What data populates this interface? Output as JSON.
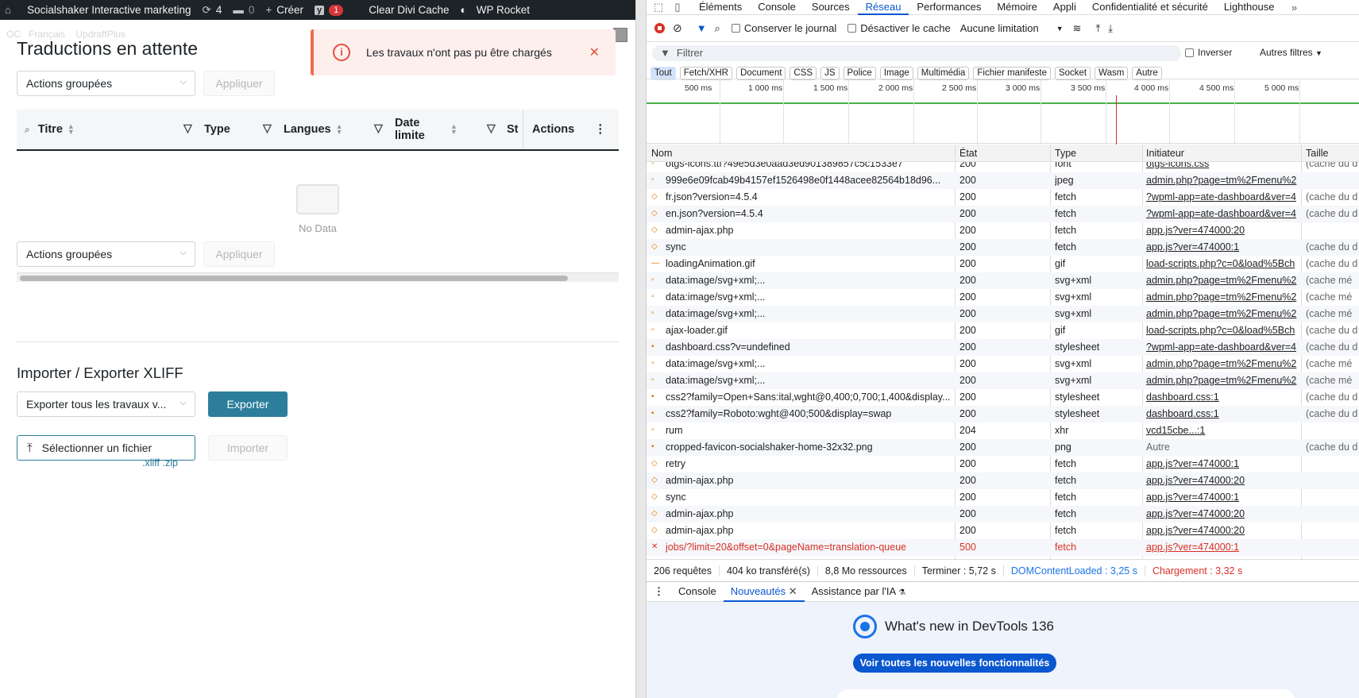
{
  "adminbar": {
    "site_name": "Socialshaker Interactive marketing",
    "updates_count": "4",
    "comments_count": "0",
    "create_label": "Créer",
    "yoast_badge": "1",
    "clear_cache": "Clear Divi Cache",
    "wp_rocket": "WP Rocket"
  },
  "subbar": {
    "lang": "Français",
    "plugin": "UpdraftPlus"
  },
  "page": {
    "title": "Traductions en attente",
    "notice_text": "Les travaux n'ont pas pu être chargés",
    "bulk_actions": "Actions groupées",
    "apply": "Appliquer",
    "no_data": "No Data",
    "columns": {
      "titre": "Titre",
      "type": "Type",
      "langues": "Langues",
      "date_limite_1": "Date",
      "date_limite_2": "limite",
      "statut_trunc": "St",
      "actions": "Actions"
    },
    "xliff_title": "Importer / Exporter XLIFF",
    "export_select": "Exporter tous les travaux v...",
    "export_button": "Exporter",
    "select_file": "Sélectionner un fichier",
    "import_button": "Importer",
    "extensions": ".xliff .zip"
  },
  "devtools": {
    "tabs": [
      "Éléments",
      "Console",
      "Sources",
      "Réseau",
      "Performances",
      "Mémoire",
      "Appli",
      "Confidentialité et sécurité",
      "Lighthouse"
    ],
    "active_tab": "Réseau",
    "toolbar": {
      "preserve_log": "Conserver le journal",
      "disable_cache": "Désactiver le cache",
      "throttle": "Aucune limitation"
    },
    "filter_placeholder": "Filtrer",
    "invert": "Inverser",
    "other_filters": "Autres filtres",
    "chips": [
      "Tout",
      "Fetch/XHR",
      "Document",
      "CSS",
      "JS",
      "Police",
      "Image",
      "Multimédia",
      "Fichier manifeste",
      "Socket",
      "Wasm",
      "Autre"
    ],
    "timeline_labels": [
      "500 ms",
      "1 000 ms",
      "1 500 ms",
      "2 000 ms",
      "2 500 ms",
      "3 000 ms",
      "3 500 ms",
      "4 000 ms",
      "4 500 ms",
      "5 000 ms"
    ],
    "columns": {
      "name": "Nom",
      "status": "État",
      "type": "Type",
      "initiator": "Initiateur",
      "size": "Taille"
    },
    "rows": [
      {
        "name": "otgs-icons.ttf?49e5d3e0aad3ed901389857c5c1533e7",
        "status": "200",
        "type": "font",
        "initiator": "otgs-icons.css",
        "size": "(cache du d",
        "icon": "▫"
      },
      {
        "name": "999e6e09fcab49b4157ef1526498e0f1448acee82564b18d96...",
        "status": "200",
        "type": "jpeg",
        "initiator": "admin.php?page=tm%2Fmenu%2",
        "size": "",
        "icon": "▫"
      },
      {
        "name": "fr.json?version=4.5.4",
        "status": "200",
        "type": "fetch",
        "initiator": "?wpml-app=ate-dashboard&ver=4",
        "size": "(cache du d",
        "icon": "◇"
      },
      {
        "name": "en.json?version=4.5.4",
        "status": "200",
        "type": "fetch",
        "initiator": "?wpml-app=ate-dashboard&ver=4",
        "size": "(cache du d",
        "icon": "◇"
      },
      {
        "name": "admin-ajax.php",
        "status": "200",
        "type": "fetch",
        "initiator": "app.js?ver=474000:20",
        "size": "",
        "icon": "◇"
      },
      {
        "name": "sync",
        "status": "200",
        "type": "fetch",
        "initiator": "app.js?ver=474000:1",
        "size": "(cache du d",
        "icon": "◇"
      },
      {
        "name": "loadingAnimation.gif",
        "status": "200",
        "type": "gif",
        "initiator": "load-scripts.php?c=0&load%5Bch",
        "size": "(cache du d",
        "icon": "—"
      },
      {
        "name": "data:image/svg+xml;...",
        "status": "200",
        "type": "svg+xml",
        "initiator": "admin.php?page=tm%2Fmenu%2",
        "size": "(cache mé",
        "icon": "▫"
      },
      {
        "name": "data:image/svg+xml;...",
        "status": "200",
        "type": "svg+xml",
        "initiator": "admin.php?page=tm%2Fmenu%2",
        "size": "(cache mé",
        "icon": "▫"
      },
      {
        "name": "data:image/svg+xml;...",
        "status": "200",
        "type": "svg+xml",
        "initiator": "admin.php?page=tm%2Fmenu%2",
        "size": "(cache mé",
        "icon": "▫"
      },
      {
        "name": "ajax-loader.gif",
        "status": "200",
        "type": "gif",
        "initiator": "load-scripts.php?c=0&load%5Bch",
        "size": "(cache du d",
        "icon": "▫"
      },
      {
        "name": "dashboard.css?v=undefined",
        "status": "200",
        "type": "stylesheet",
        "initiator": "?wpml-app=ate-dashboard&ver=4",
        "size": "(cache du d",
        "icon": "▪"
      },
      {
        "name": "data:image/svg+xml;...",
        "status": "200",
        "type": "svg+xml",
        "initiator": "admin.php?page=tm%2Fmenu%2",
        "size": "(cache mé",
        "icon": "▫"
      },
      {
        "name": "data:image/svg+xml;...",
        "status": "200",
        "type": "svg+xml",
        "initiator": "admin.php?page=tm%2Fmenu%2",
        "size": "(cache mé",
        "icon": "▫"
      },
      {
        "name": "css2?family=Open+Sans:ital,wght@0,400;0,700;1,400&display...",
        "status": "200",
        "type": "stylesheet",
        "initiator": "dashboard.css:1",
        "size": "(cache du d",
        "icon": "▪"
      },
      {
        "name": "css2?family=Roboto:wght@400;500&display=swap",
        "status": "200",
        "type": "stylesheet",
        "initiator": "dashboard.css:1",
        "size": "(cache du d",
        "icon": "▪"
      },
      {
        "name": "rum",
        "status": "204",
        "type": "xhr",
        "initiator": "vcd15cbe...:1",
        "size": "",
        "icon": "▫"
      },
      {
        "name": "cropped-favicon-socialshaker-home-32x32.png",
        "status": "200",
        "type": "png",
        "initiator": "Autre",
        "size": "(cache du d",
        "icon": "•"
      },
      {
        "name": "retry",
        "status": "200",
        "type": "fetch",
        "initiator": "app.js?ver=474000:1",
        "size": "",
        "icon": "◇"
      },
      {
        "name": "admin-ajax.php",
        "status": "200",
        "type": "fetch",
        "initiator": "app.js?ver=474000:20",
        "size": "",
        "icon": "◇"
      },
      {
        "name": "sync",
        "status": "200",
        "type": "fetch",
        "initiator": "app.js?ver=474000:1",
        "size": "",
        "icon": "◇"
      },
      {
        "name": "admin-ajax.php",
        "status": "200",
        "type": "fetch",
        "initiator": "app.js?ver=474000:20",
        "size": "",
        "icon": "◇"
      },
      {
        "name": "admin-ajax.php",
        "status": "200",
        "type": "fetch",
        "initiator": "app.js?ver=474000:20",
        "size": "",
        "icon": "◇"
      },
      {
        "name": "jobs/?limit=20&offset=0&pageName=translation-queue",
        "status": "500",
        "type": "fetch",
        "initiator": "app.js?ver=474000:1",
        "size": "",
        "icon": "✕",
        "error": true
      }
    ],
    "status_bar": {
      "requests": "206 requêtes",
      "transferred": "404 ko transféré(s)",
      "resources": "8,8 Mo ressources",
      "finish": "Terminer : 5,72 s",
      "dcl": "DOMContentLoaded : 3,25 s",
      "load": "Chargement : 3,32 s"
    },
    "drawer": {
      "tabs": [
        "Console",
        "Nouveautés",
        "Assistance par l'IA"
      ],
      "active": "Nouveautés",
      "whats_new_title": "What's new in DevTools 136",
      "whats_new_button": "Voir toutes les nouvelles fonctionnalités"
    }
  },
  "colors": {
    "wp_bar": "#1d2327",
    "accent_teal": "#2d7e9b",
    "notice_red": "#e2503e",
    "devtools_blue": "#0b57d0",
    "error_red": "#d93025"
  }
}
